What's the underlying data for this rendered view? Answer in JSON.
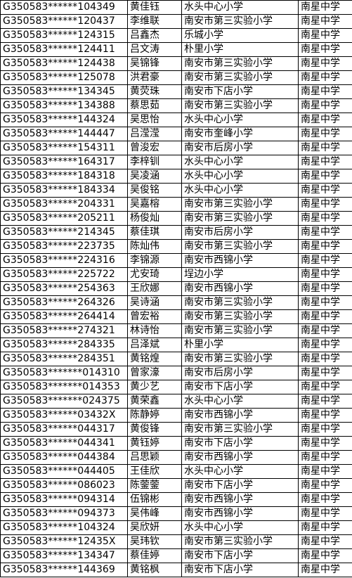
{
  "rows": [
    [
      "G350583******104349",
      "黄佳钰",
      "水头中心小学",
      "南星中学"
    ],
    [
      "G350583******120437",
      "李维联",
      "南安市第三实验小学",
      "南星中学"
    ],
    [
      "G350583******124315",
      "吕鑫杰",
      "乐城小学",
      "南星中学"
    ],
    [
      "G350583******124411",
      "吕文涛",
      "朴里小学",
      "南星中学"
    ],
    [
      "G350583******124438",
      "吴锦锋",
      "南安市第三实验小学",
      "南星中学"
    ],
    [
      "G350583******125078",
      "洪君豪",
      "南安市第三实验小学",
      "南星中学"
    ],
    [
      "G350583******134345",
      "黄荧珠",
      "南安市下店小学",
      "南星中学"
    ],
    [
      "G350583******134388",
      "蔡思茹",
      "南安市第三实验小学",
      "南星中学"
    ],
    [
      "G350583******144324",
      "吴思怡",
      "水头中心小学",
      "南星中学"
    ],
    [
      "G350583******144447",
      "吕滢滢",
      "南安市奎峰小学",
      "南星中学"
    ],
    [
      "G350583******154311",
      "曾浚宏",
      "南安市后房小学",
      "南星中学"
    ],
    [
      "G350583******164317",
      "李梓钏",
      "水头中心小学",
      "南星中学"
    ],
    [
      "G350583******184318",
      "吴凌涵",
      "水头中心小学",
      "南星中学"
    ],
    [
      "G350583******184334",
      "吴俊铭",
      "水头中心小学",
      "南星中学"
    ],
    [
      "G350583******204331",
      "吴嘉榕",
      "南安市第三实验小学",
      "南星中学"
    ],
    [
      "G350583******205211",
      "杨俊灿",
      "南安市第三实验小学",
      "南星中学"
    ],
    [
      "G350583******214345",
      "蔡佳琪",
      "南安市后房小学",
      "南星中学"
    ],
    [
      "G350583******223735",
      "陈灿伟",
      "南安市第三实验小学",
      "南星中学"
    ],
    [
      "G350583******224316",
      "李锦源",
      "南安市西锦小学",
      "南星中学"
    ],
    [
      "G350583******225722",
      "尤安琦",
      "埕边小学",
      "南星中学"
    ],
    [
      "G350583******254363",
      "王欣娜",
      "南安市西锦小学",
      "南星中学"
    ],
    [
      "G350583******264326",
      "吴诗涵",
      "南安市第三实验小学",
      "南星中学"
    ],
    [
      "G350583******264414",
      "曾宏裕",
      "南安市第三实验小学",
      "南星中学"
    ],
    [
      "G350583******274321",
      "林诗怡",
      "南安市第三实验小学",
      "南星中学"
    ],
    [
      "G350583******284335",
      "吕泽斌",
      "朴里小学",
      "南星中学"
    ],
    [
      "G350583******284351",
      "黄铭煌",
      "南安市第三实验小学",
      "南星中学"
    ],
    [
      "G350583*******014310",
      "曾家濠",
      "南安市后房小学",
      "南星中学"
    ],
    [
      "G350583*******014353",
      "黄少艺",
      "南安市下店小学",
      "南星中学"
    ],
    [
      "G350583*******024375",
      "黄荣鑫",
      "水头中心小学",
      "南星中学"
    ],
    [
      "G350583******03432X",
      "陈静婷",
      "南安市西锦小学",
      "南星中学"
    ],
    [
      "G350583******044317",
      "黄俊锋",
      "南安市第三实验小学",
      "南星中学"
    ],
    [
      "G350583******044341",
      "黄钰婷",
      "南安市下店小学",
      "南星中学"
    ],
    [
      "G350583******044384",
      "吕思颖",
      "南安市西锦小学",
      "南星中学"
    ],
    [
      "G350583******044405",
      "王佳欣",
      "水头中心小学",
      "南星中学"
    ],
    [
      "G350583******086023",
      "陈蓥蓥",
      "南安市下店小学",
      "南星中学"
    ],
    [
      "G350583******094314",
      "伍锦彬",
      "南安市西锦小学",
      "南星中学"
    ],
    [
      "G350583******094373",
      "吴伟峰",
      "南安市西锦小学",
      "南星中学"
    ],
    [
      "G350583******104324",
      "吴欣妍",
      "水头中心小学",
      "南星中学"
    ],
    [
      "G350583******12435X",
      "吴玮钦",
      "南安市第三实验小学",
      "南星中学"
    ],
    [
      "G350583******134347",
      "蔡佳婷",
      "南安市下店小学",
      "南星中学"
    ],
    [
      "G350583******144369",
      "黄铭枫",
      "南安市下店小学",
      "南星中学"
    ]
  ]
}
